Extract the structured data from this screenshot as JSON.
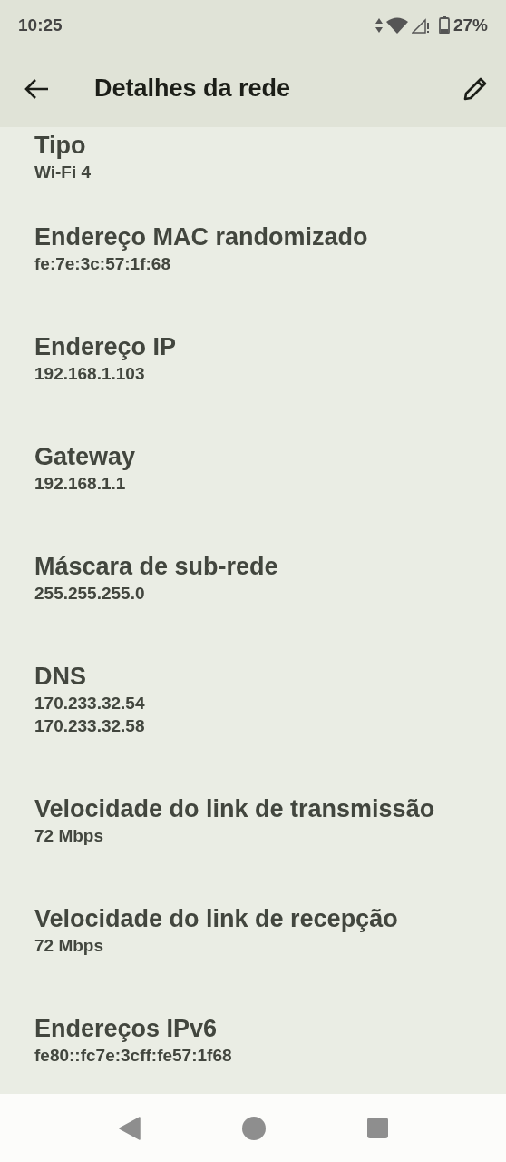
{
  "status_bar": {
    "time": "10:25",
    "battery": "27%"
  },
  "app_bar": {
    "title": "Detalhes da rede"
  },
  "details": [
    {
      "label": "Tipo",
      "values": [
        "Wi-Fi 4"
      ]
    },
    {
      "label": "Endereço MAC randomizado",
      "values": [
        "fe:7e:3c:57:1f:68"
      ]
    },
    {
      "label": "Endereço IP",
      "values": [
        "192.168.1.103"
      ]
    },
    {
      "label": "Gateway",
      "values": [
        "192.168.1.1"
      ]
    },
    {
      "label": "Máscara de sub-rede",
      "values": [
        "255.255.255.0"
      ]
    },
    {
      "label": "DNS",
      "values": [
        "170.233.32.54",
        "170.233.32.58"
      ]
    },
    {
      "label": "Velocidade do link de transmissão",
      "values": [
        "72 Mbps"
      ]
    },
    {
      "label": "Velocidade do link de recepção",
      "values": [
        "72 Mbps"
      ]
    },
    {
      "label": "Endereços IPv6",
      "values": [
        "fe80::fc7e:3cff:fe57:1f68"
      ]
    }
  ]
}
